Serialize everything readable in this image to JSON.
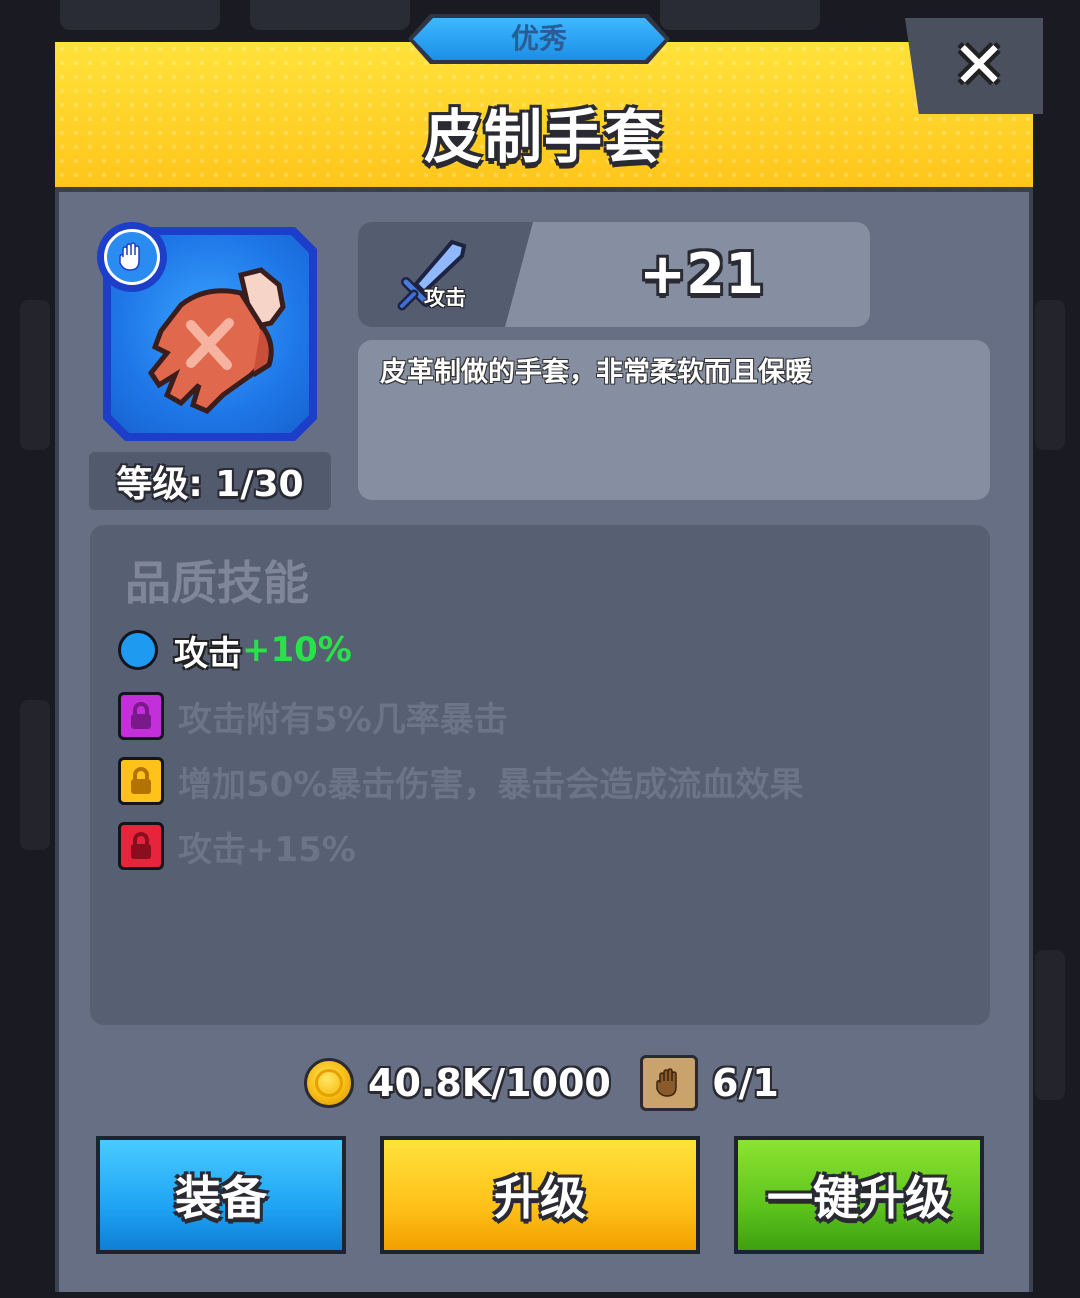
{
  "rarity": "优秀",
  "item_name": "皮制手套",
  "close_symbol": "✕",
  "item": {
    "icon": "leather-glove-icon",
    "type_icon": "hand-icon",
    "level_text": "等级: 1/30",
    "frame_color": "#1d3ec9"
  },
  "stat": {
    "icon": "sword-icon",
    "label": "攻击",
    "value": "+21"
  },
  "description": "皮革制做的手套，非常柔软而且保暖",
  "skills": {
    "title": "品质技能",
    "items": [
      {
        "name": "攻击",
        "bonus": "+10%",
        "unlocked": true,
        "color": "#1e9bf0"
      },
      {
        "text": "攻击附有5%几率暴击",
        "unlocked": false,
        "color": "#c32fd8"
      },
      {
        "text": "增加50%暴击伤害，暴击会造成流血效果",
        "unlocked": false,
        "color": "#ffc21a"
      },
      {
        "text": "攻击+15%",
        "unlocked": false,
        "color": "#e8233c"
      }
    ]
  },
  "costs": {
    "gold": "40.8K/1000",
    "gold_icon": "gold-coin-icon",
    "scroll": "6/1",
    "scroll_icon": "glove-scroll-icon"
  },
  "buttons": {
    "equip": "装备",
    "upgrade": "升级",
    "one_click_upgrade": "一键升级"
  },
  "colors": {
    "header_yellow": "#ffc51b",
    "panel_gray": "#676f84",
    "bonus_green": "#29e14a",
    "equip_blue": "#1fa4f5",
    "upgrade_yellow": "#ffc11a",
    "oneclick_green": "#5ec41d"
  }
}
